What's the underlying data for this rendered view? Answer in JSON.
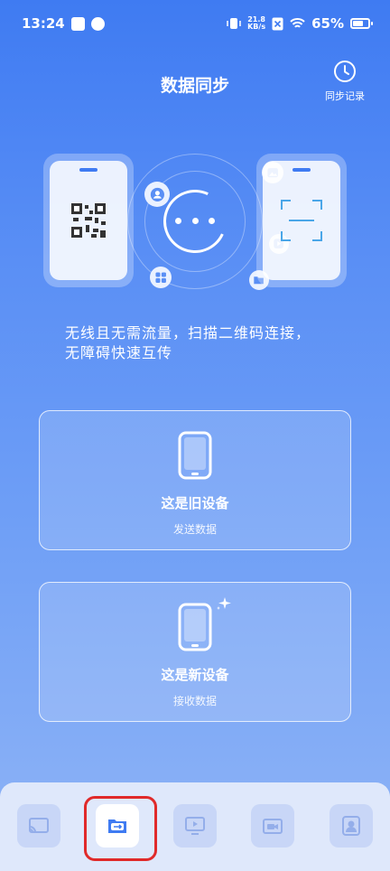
{
  "status_bar": {
    "time": "13:24",
    "net_speed_value": "21.8",
    "net_speed_unit": "KB/s",
    "battery_percent": "65%"
  },
  "header": {
    "title": "数据同步",
    "history_label": "同步记录",
    "history_icon": "clock-icon"
  },
  "description": {
    "line1": "无线且无需流量，扫描二维码连接，",
    "line2": "无障碍快速互传"
  },
  "options": {
    "old_device": {
      "title": "这是旧设备",
      "subtitle": "发送数据",
      "icon": "phone-icon"
    },
    "new_device": {
      "title": "这是新设备",
      "subtitle": "接收数据",
      "icon": "phone-sparkle-icon"
    }
  },
  "dock": {
    "items": [
      {
        "icon": "cast-icon",
        "active": false
      },
      {
        "icon": "file-sync-icon",
        "active": true
      },
      {
        "icon": "screen-icon",
        "active": false
      },
      {
        "icon": "video-call-icon",
        "active": false
      },
      {
        "icon": "contact-icon",
        "active": false
      }
    ]
  },
  "colors": {
    "accent": "#3f7bf2",
    "highlight_border": "#e02a2a",
    "dock_background": "#dfe8fb"
  }
}
